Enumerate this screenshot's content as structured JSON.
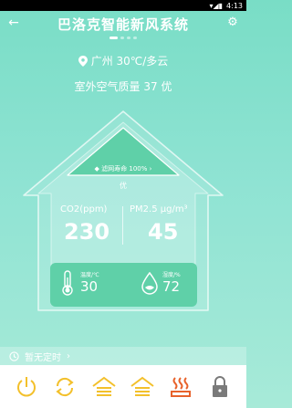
{
  "status_bar": {
    "time": "4:13"
  },
  "header": {
    "title": "巴洛克智能新风系统"
  },
  "pager": {
    "count": 4,
    "active": 0
  },
  "location": {
    "city_weather": "广州 30℃/多云"
  },
  "outdoor": {
    "air_quality": "室外空气质量 37 优"
  },
  "filter": {
    "life_label": "滤网寿命 100%",
    "life_percent": 100
  },
  "indoor_quality": "优",
  "metrics": {
    "co2": {
      "label": "CO2(ppm)",
      "value": "230"
    },
    "pm25": {
      "label": "PM2.5 μg/m³",
      "value": "45"
    }
  },
  "sensors": {
    "temperature": {
      "label": "温度/℃",
      "value": "30"
    },
    "humidity": {
      "label": "湿度/%",
      "value": "72"
    }
  },
  "timer": {
    "label": "暂无定时"
  },
  "colors": {
    "bg_top": "#79ddc6",
    "house_fill": "#5fd0a8",
    "accent_yellow": "#f3c02b",
    "accent_orange": "#e8622b",
    "lock_gray": "#7a7a7a"
  },
  "controls": [
    {
      "name": "power",
      "icon": "power-icon"
    },
    {
      "name": "mode",
      "icon": "cycle-icon"
    },
    {
      "name": "wind-1",
      "icon": "house-wind-icon"
    },
    {
      "name": "wind-2",
      "icon": "house-wind-icon"
    },
    {
      "name": "heat",
      "icon": "heat-icon"
    },
    {
      "name": "lock",
      "icon": "lock-icon"
    }
  ]
}
